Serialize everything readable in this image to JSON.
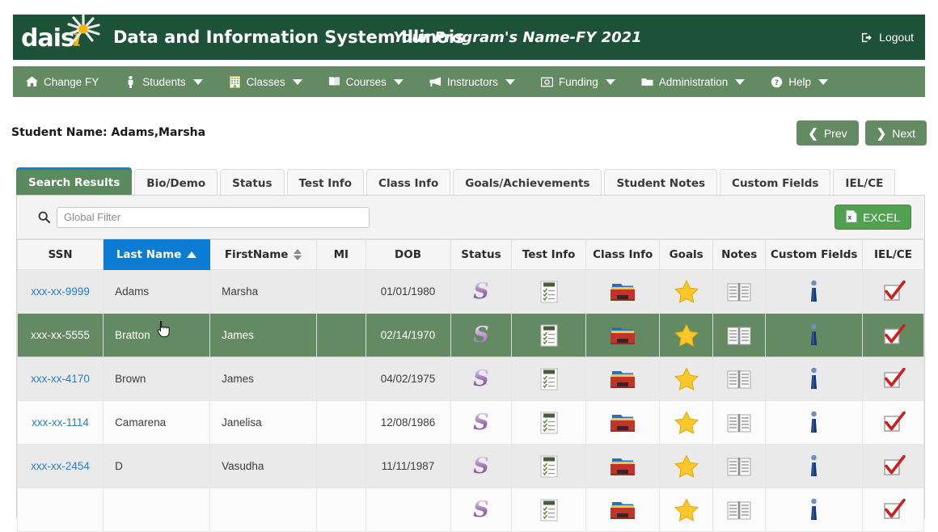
{
  "header": {
    "logo_text": "dais",
    "logo_i": "i",
    "app_title": "Data and Information System Illinois",
    "program_title": "Your Program's Name-FY 2021",
    "logout_label": "Logout",
    "bg_color": "#1d5138"
  },
  "nav": {
    "bg_color": "#648a63",
    "items": [
      {
        "label": "Change FY",
        "icon": "home-icon",
        "has_caret": false
      },
      {
        "label": "Students",
        "icon": "person-icon",
        "has_caret": true
      },
      {
        "label": "Classes",
        "icon": "building-icon",
        "has_caret": true
      },
      {
        "label": "Courses",
        "icon": "book-icon",
        "has_caret": true
      },
      {
        "label": "Instructors",
        "icon": "megaphone-icon",
        "has_caret": true
      },
      {
        "label": "Funding",
        "icon": "money-icon",
        "has_caret": true
      },
      {
        "label": "Administration",
        "icon": "folder-icon",
        "has_caret": true
      },
      {
        "label": "Help",
        "icon": "question-circle-icon",
        "has_caret": true
      }
    ]
  },
  "page": {
    "student_name_label": "Student Name: Adams,Marsha",
    "prev_label": "Prev",
    "next_label": "Next"
  },
  "tabs": [
    {
      "label": "Search Results",
      "active": true
    },
    {
      "label": "Bio/Demo",
      "active": false
    },
    {
      "label": "Status",
      "active": false
    },
    {
      "label": "Test Info",
      "active": false
    },
    {
      "label": "Class Info",
      "active": false
    },
    {
      "label": "Goals/Achievements",
      "active": false
    },
    {
      "label": "Student Notes",
      "active": false
    },
    {
      "label": "Custom Fields",
      "active": false
    },
    {
      "label": "IEL/CE",
      "active": false
    }
  ],
  "toolbar": {
    "filter_placeholder": "Global Filter",
    "filter_value": "",
    "excel_label": "EXCEL"
  },
  "table": {
    "columns": [
      {
        "label": "SSN",
        "sort": "none"
      },
      {
        "label": "Last Name",
        "sort": "asc"
      },
      {
        "label": "FirstName",
        "sort": "both"
      },
      {
        "label": "MI",
        "sort": "none"
      },
      {
        "label": "DOB",
        "sort": "none"
      },
      {
        "label": "Status",
        "sort": "none"
      },
      {
        "label": "Test Info",
        "sort": "none"
      },
      {
        "label": "Class Info",
        "sort": "none"
      },
      {
        "label": "Goals",
        "sort": "none"
      },
      {
        "label": "Notes",
        "sort": "none"
      },
      {
        "label": "Custom Fields",
        "sort": "none"
      },
      {
        "label": "IEL/CE",
        "sort": "none"
      }
    ],
    "rows": [
      {
        "ssn": "xxx-xx-9999",
        "last_name": "Adams",
        "first_name": "Marsha",
        "mi": "",
        "dob": "01/01/1980",
        "highlighted": false,
        "icons": [
          "status-s-icon",
          "test-info-clipboard-icon",
          "class-info-folders-icon",
          "goals-star-icon",
          "notes-book-icon",
          "custom-fields-info-icon",
          "iel-ce-checkmark-icon"
        ]
      },
      {
        "ssn": "xxx-xx-5555",
        "last_name": "Bratton",
        "first_name": "James",
        "mi": "",
        "dob": "02/14/1970",
        "highlighted": true,
        "icons": [
          "status-s-icon",
          "test-info-clipboard-icon",
          "class-info-folders-icon",
          "goals-star-icon",
          "notes-book-icon",
          "custom-fields-info-icon",
          "iel-ce-checkmark-icon"
        ]
      },
      {
        "ssn": "xxx-xx-4170",
        "last_name": "Brown",
        "first_name": "James",
        "mi": "",
        "dob": "04/02/1975",
        "highlighted": false,
        "icons": [
          "status-s-icon",
          "test-info-clipboard-icon",
          "class-info-folders-icon",
          "goals-star-icon",
          "notes-book-icon",
          "custom-fields-info-icon",
          "iel-ce-checkmark-icon"
        ]
      },
      {
        "ssn": "xxx-xx-1114",
        "last_name": "Camarena",
        "first_name": "Janelisa",
        "mi": "",
        "dob": "12/08/1986",
        "highlighted": false,
        "icons": [
          "status-s-icon",
          "test-info-clipboard-icon",
          "class-info-folders-icon",
          "goals-star-icon",
          "notes-book-icon",
          "custom-fields-info-icon",
          "iel-ce-checkmark-icon"
        ]
      },
      {
        "ssn": "xxx-xx-2454",
        "last_name": "D",
        "first_name": "Vasudha",
        "mi": "",
        "dob": "11/11/1987",
        "highlighted": false,
        "icons": [
          "status-s-icon",
          "test-info-clipboard-icon",
          "class-info-folders-icon",
          "goals-star-icon",
          "notes-book-icon",
          "custom-fields-info-icon",
          "iel-ce-checkmark-icon"
        ]
      },
      {
        "ssn": "",
        "last_name": "",
        "first_name": "",
        "mi": "",
        "dob": "",
        "highlighted": false,
        "icons": [
          "status-s-icon",
          "test-info-clipboard-icon",
          "class-info-folders-icon",
          "goals-star-icon",
          "notes-book-icon",
          "custom-fields-info-icon",
          "iel-ce-checkmark-icon"
        ]
      }
    ]
  },
  "colors": {
    "header_green": "#1d5138",
    "nav_green": "#648a63",
    "row_highlight": "#648a63",
    "sort_blue": "#0c7cd5",
    "link_blue": "#2b7ec4",
    "excel_green": "#52a052",
    "active_tab_top": "#1b7fc4"
  }
}
